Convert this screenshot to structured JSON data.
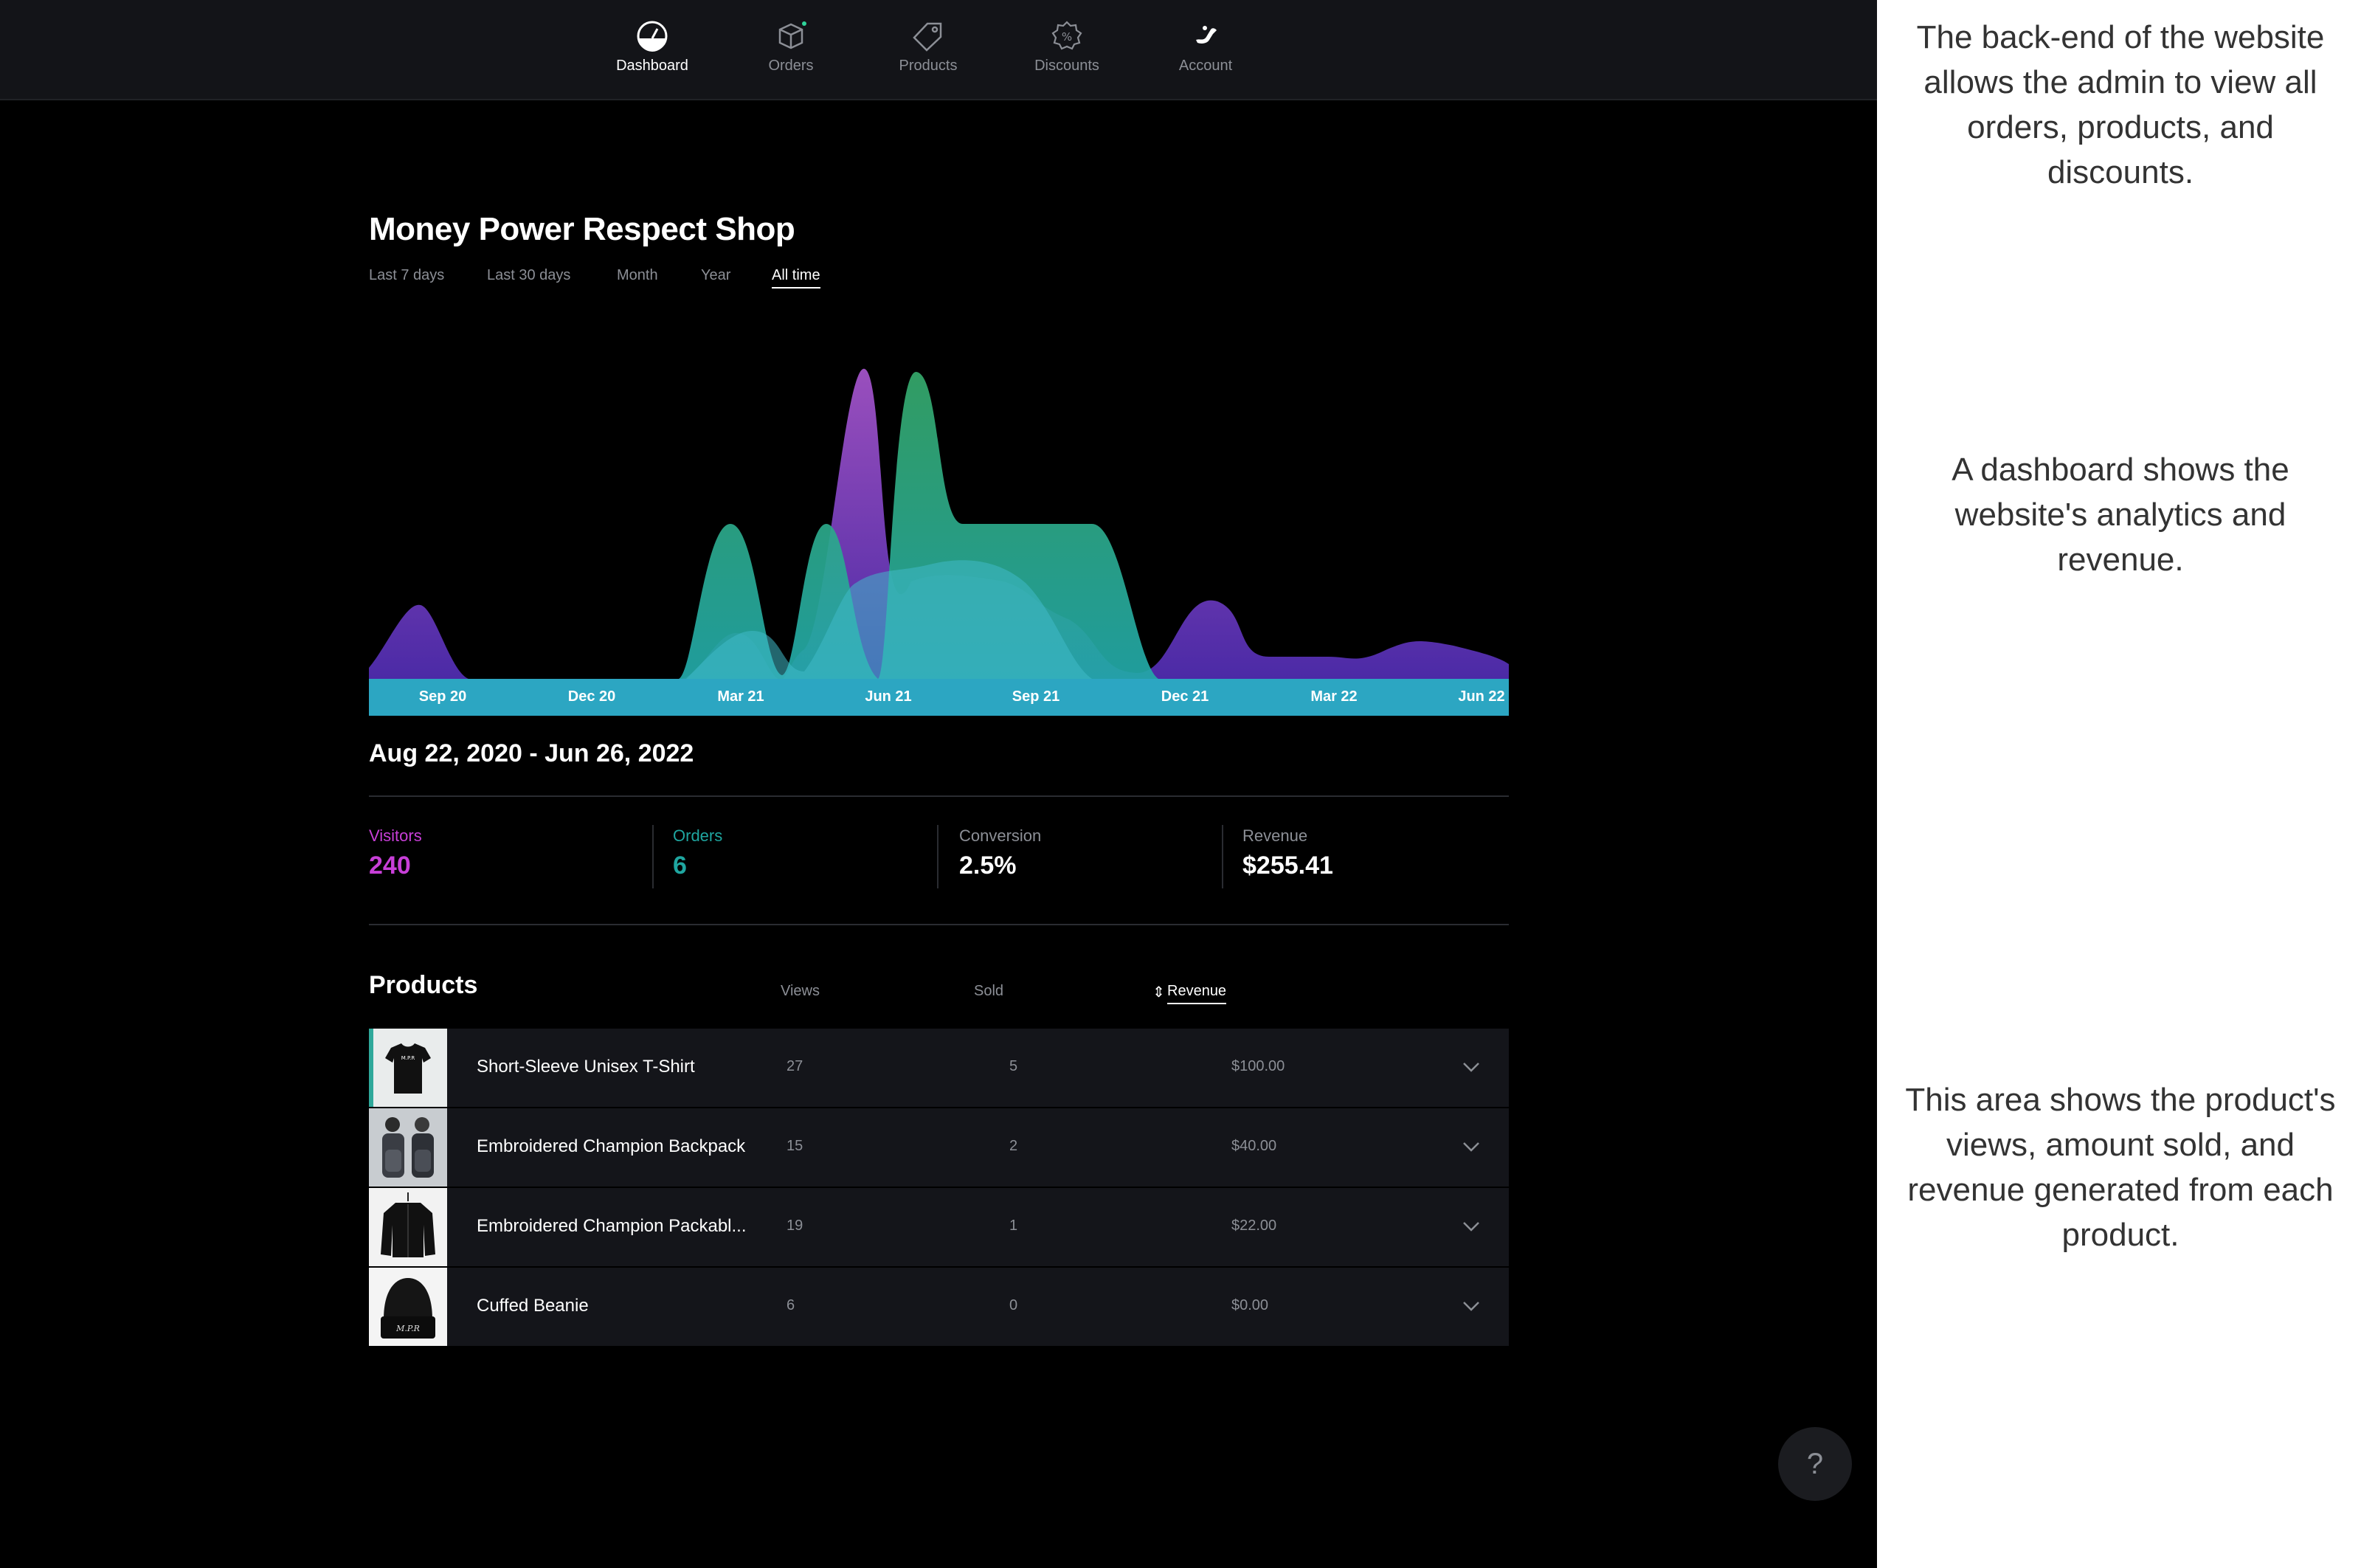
{
  "nav": {
    "items": [
      {
        "label": "Dashboard",
        "icon": "dashboard-gauge-icon",
        "active": true
      },
      {
        "label": "Orders",
        "icon": "box-icon",
        "active": false
      },
      {
        "label": "Products",
        "icon": "tag-icon",
        "active": false
      },
      {
        "label": "Discounts",
        "icon": "percent-badge-icon",
        "active": false
      },
      {
        "label": "Account",
        "icon": "account-icon",
        "active": false
      }
    ]
  },
  "shop": {
    "title": "Money Power Respect Shop"
  },
  "ranges": [
    {
      "label": "Last 7 days",
      "active": false
    },
    {
      "label": "Last 30 days",
      "active": false
    },
    {
      "label": "Month",
      "active": false
    },
    {
      "label": "Year",
      "active": false
    },
    {
      "label": "All time",
      "active": true
    }
  ],
  "chart_data": {
    "type": "area",
    "x_ticks": [
      "Sep 20",
      "Dec 20",
      "Mar 21",
      "Jun 21",
      "Sep 21",
      "Dec 21",
      "Mar 22",
      "Jun 22"
    ],
    "colors": {
      "visitors": "#5b2aa8",
      "visitors_peak": "#9a4fbd",
      "orders": "#2fa37a",
      "axis": "#2ca6c2"
    }
  },
  "date_range": "Aug 22, 2020 - Jun 26, 2022",
  "stats": [
    {
      "label": "Visitors",
      "value": "240",
      "color": "#c83fd8"
    },
    {
      "label": "Orders",
      "value": "6",
      "color": "#1fa6a0"
    },
    {
      "label": "Conversion",
      "value": "2.5%",
      "color": "#ffffff"
    },
    {
      "label": "Revenue",
      "value": "$255.41",
      "color": "#ffffff"
    }
  ],
  "products": {
    "title": "Products",
    "columns": {
      "views": "Views",
      "sold": "Sold",
      "revenue": "Revenue"
    },
    "rows": [
      {
        "name": "Short-Sleeve Unisex T-Shirt",
        "views": "27",
        "sold": "5",
        "revenue": "$100.00"
      },
      {
        "name": "Embroidered Champion Backpack",
        "views": "15",
        "sold": "2",
        "revenue": "$40.00"
      },
      {
        "name": "Embroidered Champion Packabl...",
        "views": "19",
        "sold": "1",
        "revenue": "$22.00"
      },
      {
        "name": "Cuffed Beanie",
        "views": "6",
        "sold": "0",
        "revenue": "$0.00"
      }
    ]
  },
  "help": {
    "label": "?"
  },
  "annotations": [
    "The back-end of the website allows the admin to view all orders, products, and discounts.",
    "A dashboard shows the website's analytics and revenue.",
    "This area shows the product's views, amount sold, and revenue generated from each product."
  ]
}
